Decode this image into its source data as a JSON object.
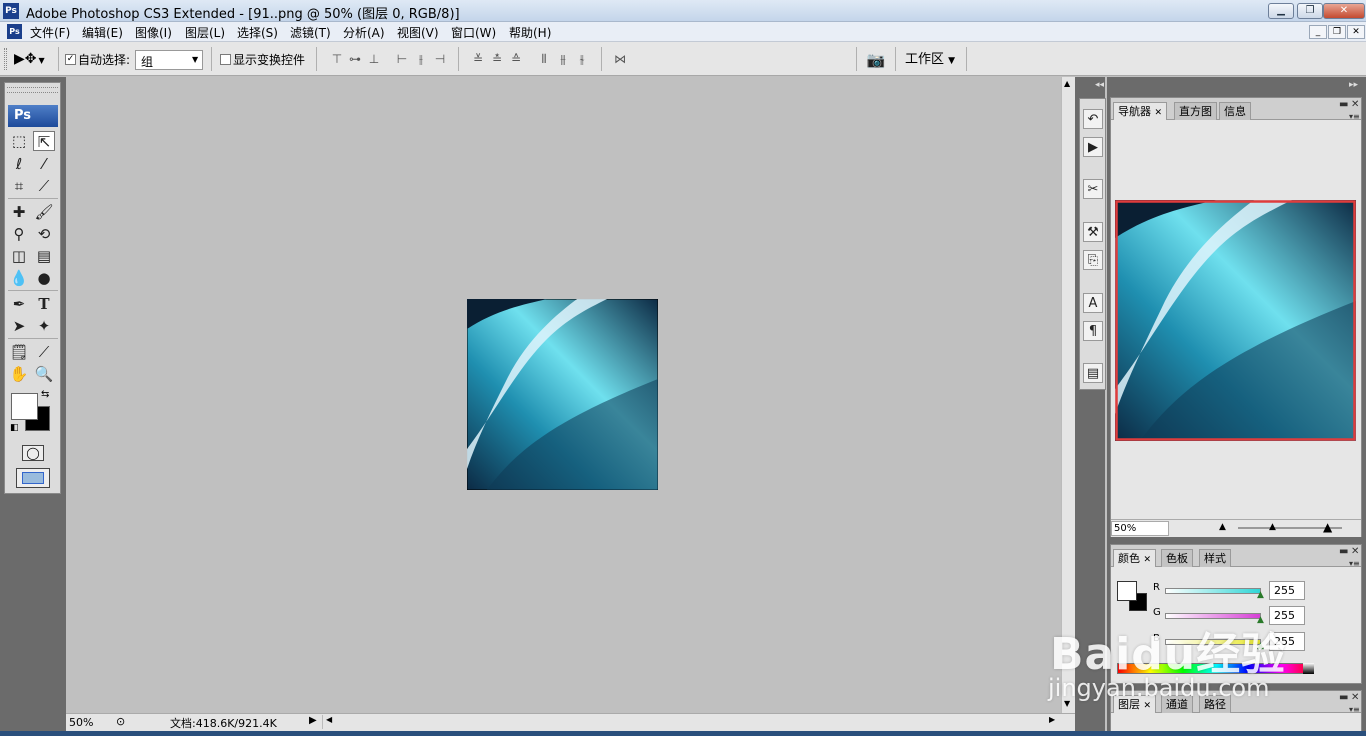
{
  "window": {
    "app_icon": "Ps",
    "title": "Adobe Photoshop CS3 Extended - [91..png @ 50% (图层 0, RGB/8)]",
    "controls": [
      "minimize-icon",
      "maximize-icon",
      "close-icon"
    ]
  },
  "menubar": {
    "app_icon": "Ps",
    "items": [
      "文件(F)",
      "编辑(E)",
      "图像(I)",
      "图层(L)",
      "选择(S)",
      "滤镜(T)",
      "分析(A)",
      "视图(V)",
      "窗口(W)",
      "帮助(H)"
    ]
  },
  "options": {
    "auto_select_label": "自动选择:",
    "auto_select_checked": true,
    "auto_select_value": "组",
    "show_transform_label": "显示变换控件",
    "show_transform_checked": false,
    "workspace_label": "工作区"
  },
  "toolbox": {
    "logo": "Ps",
    "foreground_color": "#ffffff",
    "background_color": "#000000"
  },
  "document": {
    "image_description_icon": "ocean-wave-image",
    "colors": {
      "deep": "#0c2a44",
      "mid": "#1f8fb0",
      "light": "#6fe0ee",
      "foam": "#dff3fb"
    }
  },
  "statusbar": {
    "zoom": "50%",
    "doc_info": "文档:418.6K/921.4K"
  },
  "navigator": {
    "tabs": [
      "导航器",
      "直方图",
      "信息"
    ],
    "zoom": "50%",
    "proxy_border_color": "#e03c3c"
  },
  "color_panel": {
    "tabs": [
      "颜色",
      "色板",
      "样式"
    ],
    "channels": [
      {
        "label": "R",
        "value": "255",
        "color": "#2fd6d6"
      },
      {
        "label": "G",
        "value": "255",
        "color": "#d63fd6"
      },
      {
        "label": "B",
        "value": "255",
        "color": "#e8e82f"
      }
    ]
  },
  "layers_panel": {
    "tabs": [
      "图层",
      "通道",
      "路径"
    ]
  },
  "watermark": {
    "line1": "Baidu经验",
    "line2": "jingyan.baidu.com"
  }
}
